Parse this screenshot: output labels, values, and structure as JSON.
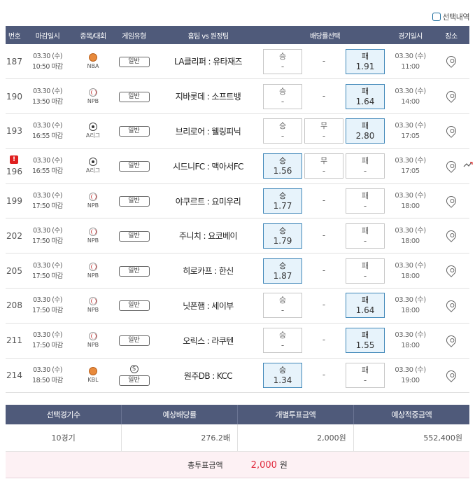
{
  "top": {
    "select_label": "선택내역"
  },
  "headers": [
    "번호",
    "마감일시",
    "종목/대회",
    "게임유형",
    "홈팀 vs 원정팀",
    "배당률선택",
    "경기일시",
    "장소"
  ],
  "rows": [
    {
      "no": "187",
      "deadline_date": "03.30 (수)",
      "deadline_time": "10:50 마감",
      "sport": "NBA",
      "sport_icon": "basketball-icon",
      "type": "일반",
      "match": "LA클리퍼 : 유타재즈",
      "odds": [
        {
          "label": "승",
          "value": "-",
          "selected": false
        },
        {
          "label": "",
          "value": "-",
          "selected": false,
          "plain": true
        },
        {
          "label": "패",
          "value": "1.91",
          "selected": true
        }
      ],
      "game_date": "03.30 (수)",
      "game_time": "11:00"
    },
    {
      "no": "190",
      "deadline_date": "03.30 (수)",
      "deadline_time": "13:50 마감",
      "sport": "NPB",
      "sport_icon": "baseball-icon",
      "type": "일반",
      "match": "지바롯데 : 소프트뱅",
      "odds": [
        {
          "label": "승",
          "value": "-",
          "selected": false
        },
        {
          "label": "",
          "value": "-",
          "selected": false,
          "plain": true
        },
        {
          "label": "패",
          "value": "1.64",
          "selected": true
        }
      ],
      "game_date": "03.30 (수)",
      "game_time": "14:00"
    },
    {
      "no": "193",
      "deadline_date": "03.30 (수)",
      "deadline_time": "16:55 마감",
      "sport": "A리그",
      "sport_icon": "soccer-icon",
      "type": "일반",
      "match": "브리로어 : 웰링피닉",
      "odds": [
        {
          "label": "승",
          "value": "-",
          "selected": false
        },
        {
          "label": "무",
          "value": "-",
          "selected": false
        },
        {
          "label": "패",
          "value": "2.80",
          "selected": true
        }
      ],
      "game_date": "03.30 (수)",
      "game_time": "17:05"
    },
    {
      "no": "196",
      "flag": "!",
      "deadline_date": "03.30 (수)",
      "deadline_time": "16:55 마감",
      "sport": "A리그",
      "sport_icon": "soccer-icon",
      "type": "일반",
      "match": "시드니FC : 맥아서FC",
      "odds": [
        {
          "label": "승",
          "value": "1.56",
          "selected": true
        },
        {
          "label": "무",
          "value": "-",
          "selected": false
        },
        {
          "label": "패",
          "value": "-",
          "selected": false
        }
      ],
      "game_date": "03.30 (수)",
      "game_time": "17:05",
      "trend": true
    },
    {
      "no": "199",
      "deadline_date": "03.30 (수)",
      "deadline_time": "17:50 마감",
      "sport": "NPB",
      "sport_icon": "baseball-icon",
      "type": "일반",
      "match": "야쿠르트 : 요미우리",
      "odds": [
        {
          "label": "승",
          "value": "1.77",
          "selected": true
        },
        {
          "label": "",
          "value": "-",
          "selected": false,
          "plain": true
        },
        {
          "label": "패",
          "value": "-",
          "selected": false
        }
      ],
      "game_date": "03.30 (수)",
      "game_time": "18:00"
    },
    {
      "no": "202",
      "deadline_date": "03.30 (수)",
      "deadline_time": "17:50 마감",
      "sport": "NPB",
      "sport_icon": "baseball-icon",
      "type": "일반",
      "match": "주니치 : 요코베이",
      "odds": [
        {
          "label": "승",
          "value": "1.79",
          "selected": true
        },
        {
          "label": "",
          "value": "-",
          "selected": false,
          "plain": true
        },
        {
          "label": "패",
          "value": "-",
          "selected": false
        }
      ],
      "game_date": "03.30 (수)",
      "game_time": "18:00"
    },
    {
      "no": "205",
      "deadline_date": "03.30 (수)",
      "deadline_time": "17:50 마감",
      "sport": "NPB",
      "sport_icon": "baseball-icon",
      "type": "일반",
      "match": "히로카프 : 한신",
      "odds": [
        {
          "label": "승",
          "value": "1.87",
          "selected": true
        },
        {
          "label": "",
          "value": "-",
          "selected": false,
          "plain": true
        },
        {
          "label": "패",
          "value": "-",
          "selected": false
        }
      ],
      "game_date": "03.30 (수)",
      "game_time": "18:00"
    },
    {
      "no": "208",
      "deadline_date": "03.30 (수)",
      "deadline_time": "17:50 마감",
      "sport": "NPB",
      "sport_icon": "baseball-icon",
      "type": "일반",
      "match": "닛폰햄 : 세이부",
      "odds": [
        {
          "label": "승",
          "value": "-",
          "selected": false
        },
        {
          "label": "",
          "value": "-",
          "selected": false,
          "plain": true
        },
        {
          "label": "패",
          "value": "1.64",
          "selected": true
        }
      ],
      "game_date": "03.30 (수)",
      "game_time": "18:00"
    },
    {
      "no": "211",
      "deadline_date": "03.30 (수)",
      "deadline_time": "17:50 마감",
      "sport": "NPB",
      "sport_icon": "baseball-icon",
      "type": "일반",
      "match": "오릭스 : 라쿠텐",
      "odds": [
        {
          "label": "승",
          "value": "-",
          "selected": false
        },
        {
          "label": "",
          "value": "-",
          "selected": false,
          "plain": true
        },
        {
          "label": "패",
          "value": "1.55",
          "selected": true
        }
      ],
      "game_date": "03.30 (수)",
      "game_time": "18:00"
    },
    {
      "no": "214",
      "deadline_date": "03.30 (수)",
      "deadline_time": "18:50 마감",
      "sport": "KBL",
      "sport_icon": "basketball-icon",
      "type": "일반",
      "special": "S",
      "match": "원주DB : KCC",
      "odds": [
        {
          "label": "승",
          "value": "1.34",
          "selected": true
        },
        {
          "label": "",
          "value": "-",
          "selected": false,
          "plain": true
        },
        {
          "label": "패",
          "value": "-",
          "selected": false
        }
      ],
      "game_date": "03.30 (수)",
      "game_time": "19:00"
    }
  ],
  "summary": {
    "headers": [
      "선택경기수",
      "예상배당률",
      "개별투표금액",
      "예상적중금액"
    ],
    "values": [
      "10경기",
      "276.2배",
      "2,000원",
      "552,400원"
    ],
    "total_label": "총투표금액",
    "total_amount": "2,000",
    "total_unit": "원"
  },
  "colors": {
    "header_bg": "#4f5a7a",
    "selected_bg": "#e7f3fb",
    "selected_border": "#3e86b8",
    "total_bg": "#fdf1f4",
    "total_amount": "#e0263a"
  }
}
